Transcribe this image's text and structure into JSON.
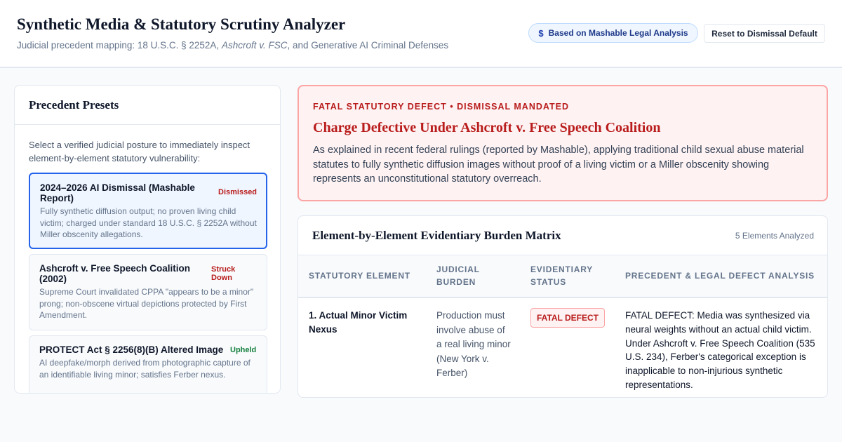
{
  "header": {
    "title": "Synthetic Media & Statutory Scrutiny Analyzer",
    "subtitle_prefix": "Judicial precedent mapping: 18 U.S.C. § 2252A, ",
    "subtitle_case": "Ashcroft v. FSC",
    "subtitle_suffix": ", and Generative AI Criminal Defenses",
    "source_badge": "Based on Mashable Legal Analysis",
    "source_icon": "dollar-sign-icon",
    "reset_label": "Reset to Dismissal Default"
  },
  "presets": {
    "title": "Precedent Presets",
    "intro": "Select a verified judicial posture to immediately inspect element-by-element statutory vulnerability:",
    "items": [
      {
        "name": "2024–2026 AI Dismissal (Mashable Report)",
        "status": "Dismissed",
        "status_color": "#b91c1c",
        "description": "Fully synthetic diffusion output; no proven living child victim; charged under standard 18 U.S.C. § 2252A without Miller obscenity allegations.",
        "active": true
      },
      {
        "name": "Ashcroft v. Free Speech Coalition (2002)",
        "status": "Struck Down",
        "status_color": "#b91c1c",
        "description": "Supreme Court invalidated CPPA \"appears to be a minor\" prong; non-obscene virtual depictions protected by First Amendment.",
        "active": false
      },
      {
        "name": "PROTECT Act § 2256(8)(B) Altered Image",
        "status": "Upheld",
        "status_color": "#15803d",
        "description": "AI deepfake/morph derived from photographic capture of an identifiable living minor; satisfies Ferber nexus.",
        "active": false
      }
    ]
  },
  "alert": {
    "kicker": "FATAL STATUTORY DEFECT • DISMISSAL MANDATED",
    "title": "Charge Defective Under Ashcroft v. Free Speech Coalition",
    "body": "As explained in recent federal rulings (reported by Mashable), applying traditional child sexual abuse material statutes to fully synthetic diffusion images without proof of a living victim or a Miller obscenity showing represents an unconstitutional statutory overreach."
  },
  "matrix": {
    "title": "Element-by-Element Evidentiary Burden Matrix",
    "count_label": "5 Elements Analyzed",
    "columns": [
      "STATUTORY ELEMENT",
      "JUDICIAL BURDEN",
      "EVIDENTIARY STATUS",
      "PRECEDENT & LEGAL DEFECT ANALYSIS"
    ],
    "rows": [
      {
        "element": "1. Actual Minor Victim Nexus",
        "burden": "Production must involve abuse of a real living minor (New York v. Ferber)",
        "status": "FATAL DEFECT",
        "analysis": "FATAL DEFECT: Media was synthesized via neural weights without an actual child victim. Under Ashcroft v. Free Speech Coalition (535 U.S. 234), Ferber's categorical exception is inapplicable to non-injurious synthetic representations."
      }
    ]
  }
}
